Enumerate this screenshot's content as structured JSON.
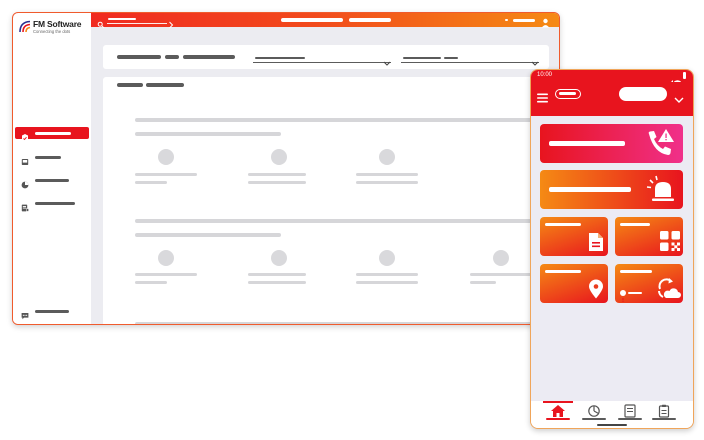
{
  "colors": {
    "brand_red": "#e8141e",
    "brand_orange": "#f58a14",
    "tile_pink": "#f0448a"
  },
  "desktop": {
    "logo": {
      "title": "FM Software",
      "tagline": "Connecting the dots"
    },
    "sidebar": {
      "items": [
        {
          "icon": "clipboard-icon",
          "active": true
        },
        {
          "icon": "book-icon",
          "active": false
        },
        {
          "icon": "pie-chart-icon",
          "active": false
        },
        {
          "icon": "report-icon",
          "active": false
        }
      ],
      "footer_icon": "chat-icon"
    },
    "topbar": {
      "search_icon": "search-icon",
      "user_icon": "user-icon"
    }
  },
  "phone": {
    "status": {
      "time": "10:00"
    },
    "appbar": {
      "menu_icon": "hamburger-icon",
      "dropdown_icon": "chevron-down-icon"
    },
    "tiles": [
      {
        "name": "phone-alert-tile",
        "icon": "phone-alert-icon"
      },
      {
        "name": "alarm-tile",
        "icon": "siren-icon"
      },
      {
        "name": "document-tile",
        "icon": "document-icon"
      },
      {
        "name": "qr-tile",
        "icon": "qr-code-icon"
      },
      {
        "name": "location-tile",
        "icon": "location-pin-icon"
      },
      {
        "name": "sync-tile",
        "icon": "cloud-sync-icon",
        "alert_icon": "alert-icon"
      }
    ],
    "bottom_nav": [
      {
        "icon": "home-icon",
        "active": true
      },
      {
        "icon": "chart-icon",
        "active": false
      },
      {
        "icon": "notes-icon",
        "active": false
      },
      {
        "icon": "clipboard-icon",
        "active": false
      }
    ]
  }
}
